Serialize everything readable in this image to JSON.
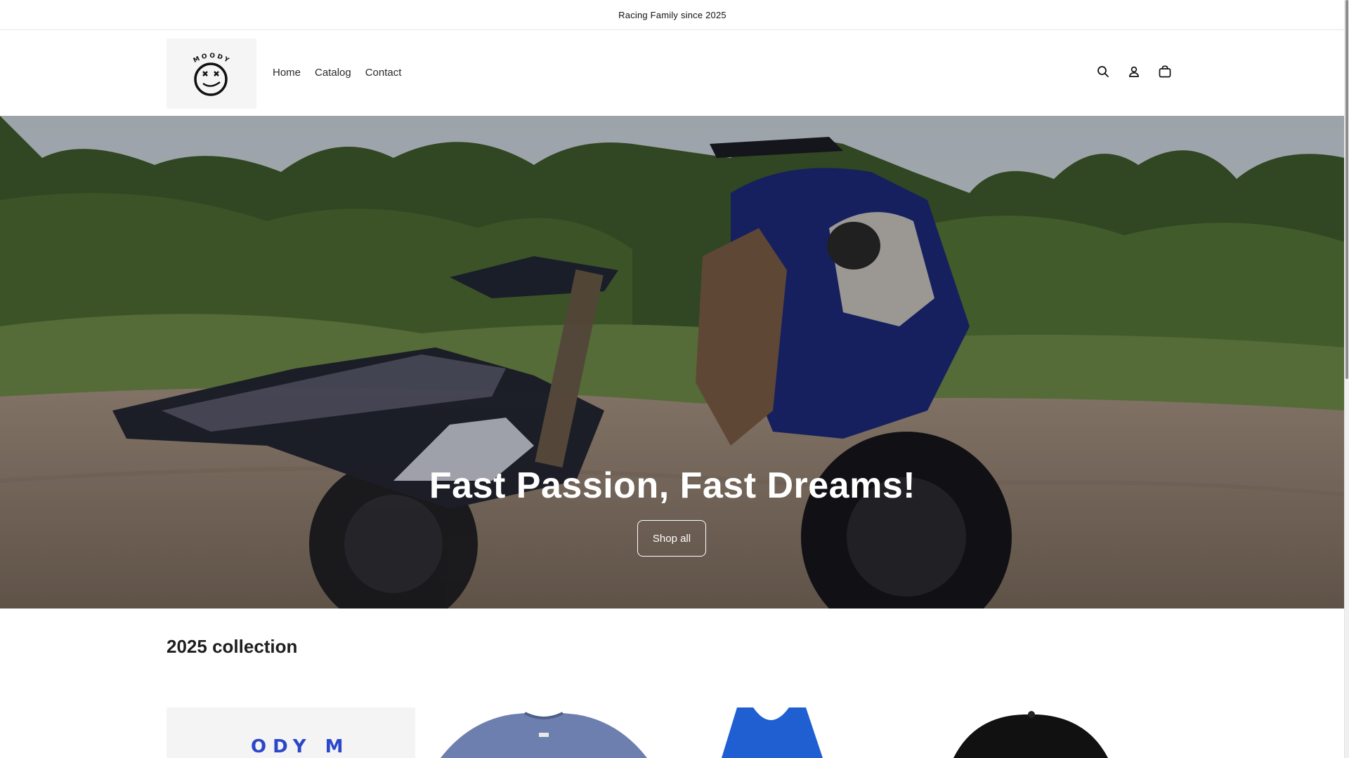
{
  "announcement": {
    "text": "Racing Family since 2025"
  },
  "header": {
    "logo_alt": "Moody Moto",
    "nav": [
      {
        "label": "Home"
      },
      {
        "label": "Catalog"
      },
      {
        "label": "Contact"
      }
    ],
    "icons": [
      "search-icon",
      "account-icon",
      "cart-icon"
    ]
  },
  "hero": {
    "title": "Fast Passion, Fast Dreams!",
    "button_label": "Shop all"
  },
  "collection": {
    "title": "2025 collection",
    "products": [
      {
        "image": "blue-print-white-shirt"
      },
      {
        "image": "heather-blue-tshirt"
      },
      {
        "image": "blue-tank-top"
      },
      {
        "image": "black-cap"
      }
    ]
  }
}
